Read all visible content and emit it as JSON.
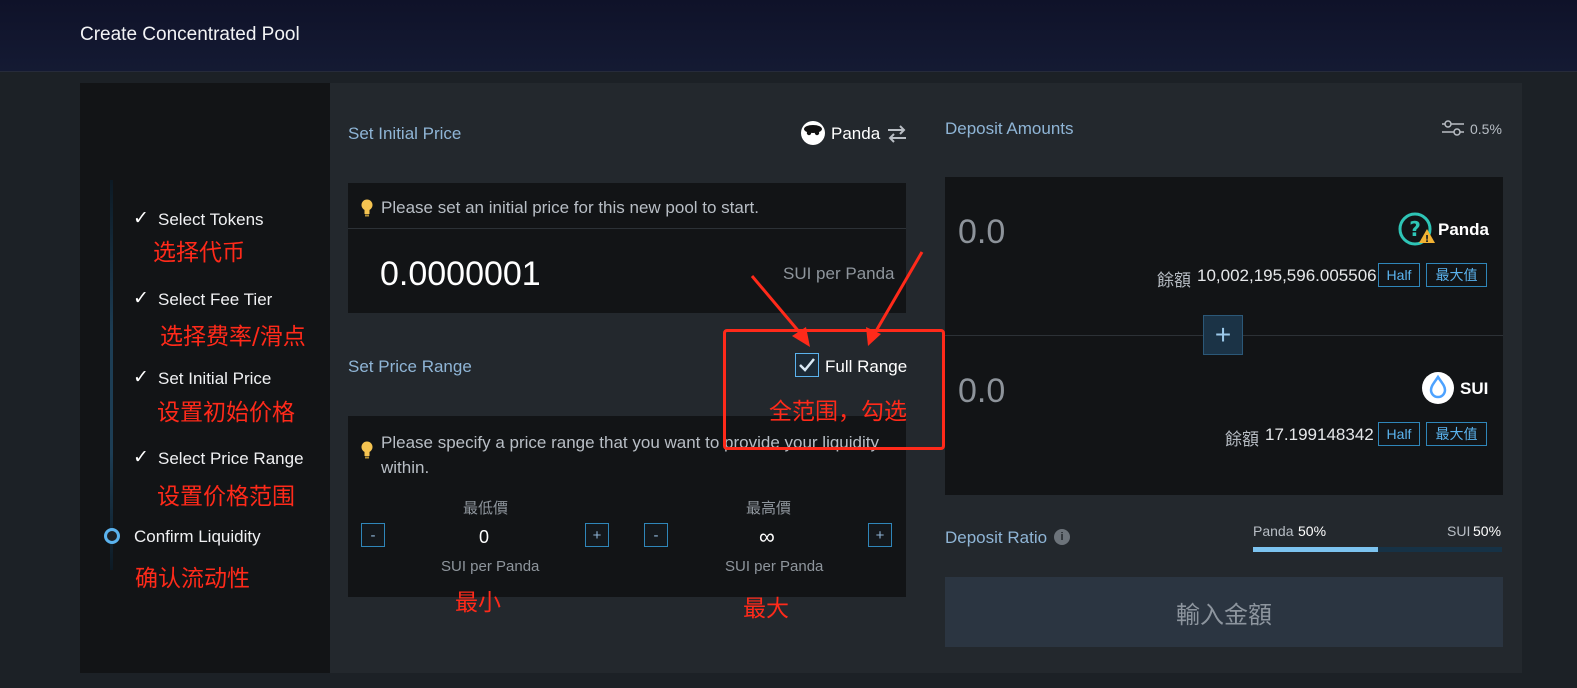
{
  "header": {
    "title": "Create Concentrated Pool"
  },
  "steps": [
    {
      "label": "Select Tokens",
      "done": true,
      "annotation": "选择代币"
    },
    {
      "label": "Select Fee Tier",
      "done": true,
      "annotation": "选择费率/滑点"
    },
    {
      "label": "Set Initial Price",
      "done": true,
      "annotation": "设置初始价格"
    },
    {
      "label": "Select Price Range",
      "done": true,
      "annotation": "设置价格范围"
    },
    {
      "label": "Confirm Liquidity",
      "done": false,
      "annotation": "确认流动性"
    }
  ],
  "check_glyph": "✓",
  "initial_price": {
    "title": "Set Initial Price",
    "base_token": "Panda",
    "hint": "Please set an initial price for this new pool to start.",
    "value": "0.0000001",
    "unit": "SUI per Panda"
  },
  "price_range": {
    "title": "Set Price Range",
    "full_range_label": "Full Range",
    "full_range_checked": true,
    "full_range_annotation": "全范围，勾选",
    "hint": "Please specify a price range that you want to provide your liquidity within.",
    "min": {
      "label": "最低價",
      "value": "0",
      "unit": "SUI per Panda",
      "annotation": "最小"
    },
    "max": {
      "label": "最高價",
      "value": "∞",
      "unit": "SUI per Panda",
      "annotation": "最大"
    },
    "minus": "-",
    "plus": "+"
  },
  "deposit": {
    "title": "Deposit Amounts",
    "slippage": "0.5%",
    "balance_label": "餘額",
    "half_label": "Half",
    "max_label": "最大值",
    "tokens": [
      {
        "amount": "0.0",
        "symbol": "Panda",
        "balance": "10,002,195,596.005506"
      },
      {
        "amount": "0.0",
        "symbol": "SUI",
        "balance": "17.199148342"
      }
    ],
    "plus": "+"
  },
  "ratio": {
    "title": "Deposit Ratio",
    "left_token": "Panda",
    "left_pct": "50%",
    "right_token": "SUI",
    "right_pct": "50%",
    "fill_fraction": 0.5
  },
  "submit_label": "輸入金額",
  "colors": {
    "accent": "#5bb3ee",
    "annotation": "#ff2a1a",
    "panel": "#121416",
    "background": "#23282d"
  }
}
